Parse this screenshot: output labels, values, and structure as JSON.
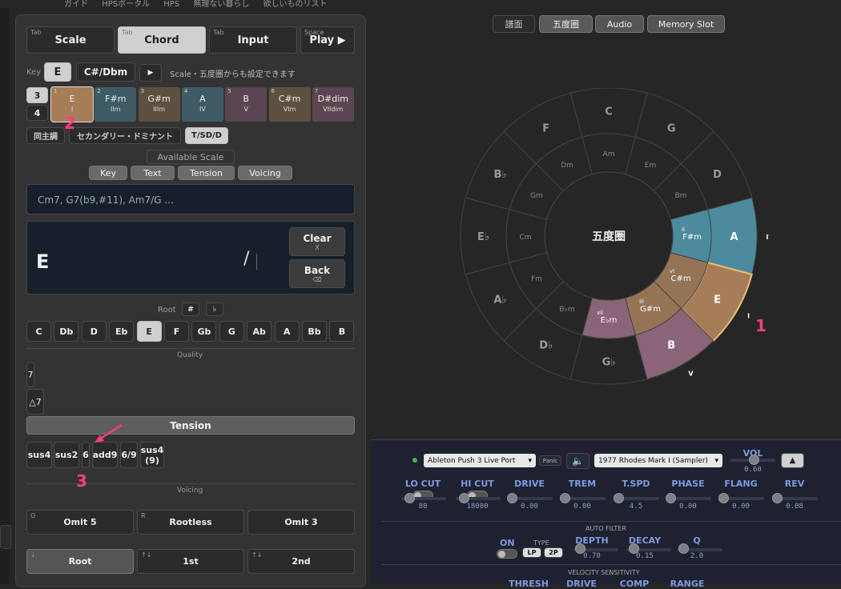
{
  "topnav": [
    "ガイド",
    "HPSポータル",
    "HPS",
    "無理ない暮らし",
    "欲しいものリスト"
  ],
  "tabs": [
    {
      "hint": "Tab",
      "label": "Scale"
    },
    {
      "hint": "Tab",
      "label": "Chord"
    },
    {
      "hint": "Tab",
      "label": "Input"
    },
    {
      "hint": "Space",
      "label": "Play ▶"
    }
  ],
  "key": {
    "label": "Key",
    "value": "E",
    "relative": "C#/Dbm",
    "play": "▶",
    "hint": "Scale・五度圏からも設定できます"
  },
  "octave": {
    "top": "3",
    "bottom": "4"
  },
  "degrees": [
    {
      "n": "1",
      "c": "E",
      "r": "I",
      "color": "#a77c58"
    },
    {
      "n": "2",
      "c": "F#m",
      "r": "IIm",
      "color": "#3f5c66"
    },
    {
      "n": "3",
      "c": "G#m",
      "r": "IIIm",
      "color": "#5e5040"
    },
    {
      "n": "4",
      "c": "A",
      "r": "IV",
      "color": "#3f5c66"
    },
    {
      "n": "5",
      "c": "B",
      "r": "V",
      "color": "#5a4550"
    },
    {
      "n": "6",
      "c": "C#m",
      "r": "VIm",
      "color": "#5e5040"
    },
    {
      "n": "7",
      "c": "D#dim",
      "r": "VIIdim",
      "color": "#5a4550"
    }
  ],
  "modes": [
    "同主調",
    "セカンダリー・ドミナント",
    "T/SD/D"
  ],
  "available_scale": "Available Scale",
  "filters": [
    "Key",
    "Text",
    "Tension",
    "Voicing"
  ],
  "input_placeholder": "Cm7, G7(b9,#11), Am7/G ...",
  "display": {
    "chord": "E",
    "slash": "/"
  },
  "clear": {
    "label": "Clear",
    "key": "X"
  },
  "back": {
    "label": "Back",
    "key": "⌫"
  },
  "root": {
    "label": "Root",
    "sharp": "#",
    "flat": "♭",
    "notes": [
      "C",
      "Db",
      "D",
      "Eb",
      "E",
      "F",
      "Gb",
      "G",
      "Ab",
      "A",
      "Bb",
      "B"
    ]
  },
  "quality": {
    "label": "Quality",
    "items": [
      "7",
      "△7"
    ]
  },
  "tension": {
    "label": "Tension",
    "items": [
      "sus4",
      "sus2",
      "6",
      "add9",
      "6/9",
      "sus4\n(9)"
    ]
  },
  "voicing": {
    "label": "Voicing",
    "row1": [
      {
        "hint": "O",
        "label": "Omit 5"
      },
      {
        "hint": "R",
        "label": "Rootless"
      },
      {
        "hint": "",
        "label": "Omit 3"
      }
    ],
    "row2": [
      {
        "hint": "↓",
        "label": "Root"
      },
      {
        "hint": "↑↓",
        "label": "1st"
      },
      {
        "hint": "↑↓",
        "label": "2nd"
      }
    ]
  },
  "markers": [
    "1",
    "2",
    "3"
  ],
  "view_tabs": [
    "譜面",
    "五度圏",
    "Audio",
    "Memory Slot"
  ],
  "circle": {
    "center": "五度圏",
    "outer": [
      "C",
      "G",
      "D",
      "A",
      "E",
      "B",
      "G♭",
      "D♭",
      "A♭",
      "E♭",
      "B♭",
      "F"
    ],
    "inner": [
      "Am",
      "Em",
      "Bm",
      "F#m",
      "C#m",
      "G#m",
      "E♭m",
      "B♭m",
      "Fm",
      "Cm",
      "Gm",
      "Dm"
    ],
    "outer_roman": {
      "A": "IV",
      "E": "I",
      "B": "V"
    },
    "inner_roman": {
      "F#m": "ii",
      "C#m": "vi",
      "G#m": "iii",
      "E♭m": "vii"
    },
    "colors": {
      "A": "#4e8a9e",
      "E": "#a77c58",
      "B": "#8a6478",
      "F#m": "#4e8a9e",
      "C#m": "#957455",
      "G#m": "#957455",
      "E♭m": "#8a6478"
    }
  },
  "synth": {
    "midi_port": "Ableton Push 3 Live Port",
    "panic": "Panic",
    "instrument": "1977 Rhodes Mark I (Sampler)",
    "vol": {
      "label": "VOL",
      "value": "0.60"
    },
    "knobs": [
      {
        "label": "LO CUT",
        "value": "80"
      },
      {
        "label": "HI CUT",
        "value": "18000"
      },
      {
        "label": "DRIVE",
        "value": "0.00"
      },
      {
        "label": "TREM",
        "value": "0.00"
      },
      {
        "label": "T.SPD",
        "value": "4.5"
      },
      {
        "label": "PHASE",
        "value": "0.00"
      },
      {
        "label": "FLANG",
        "value": "0.00"
      },
      {
        "label": "REV",
        "value": "0.08"
      }
    ],
    "auto_filter": "AUTO FILTER",
    "on": "ON",
    "type": "TYPE",
    "lp": "LP",
    "2p": "2P",
    "depth": {
      "label": "DEPTH",
      "value": "0.70"
    },
    "decay": {
      "label": "DECAY",
      "value": "0.15"
    },
    "q": {
      "label": "Q",
      "value": "2.0"
    },
    "velocity": "VELOCITY SENSITIVITY",
    "bottom": [
      "THRESH",
      "DRIVE",
      "COMP",
      "RANGE"
    ]
  }
}
